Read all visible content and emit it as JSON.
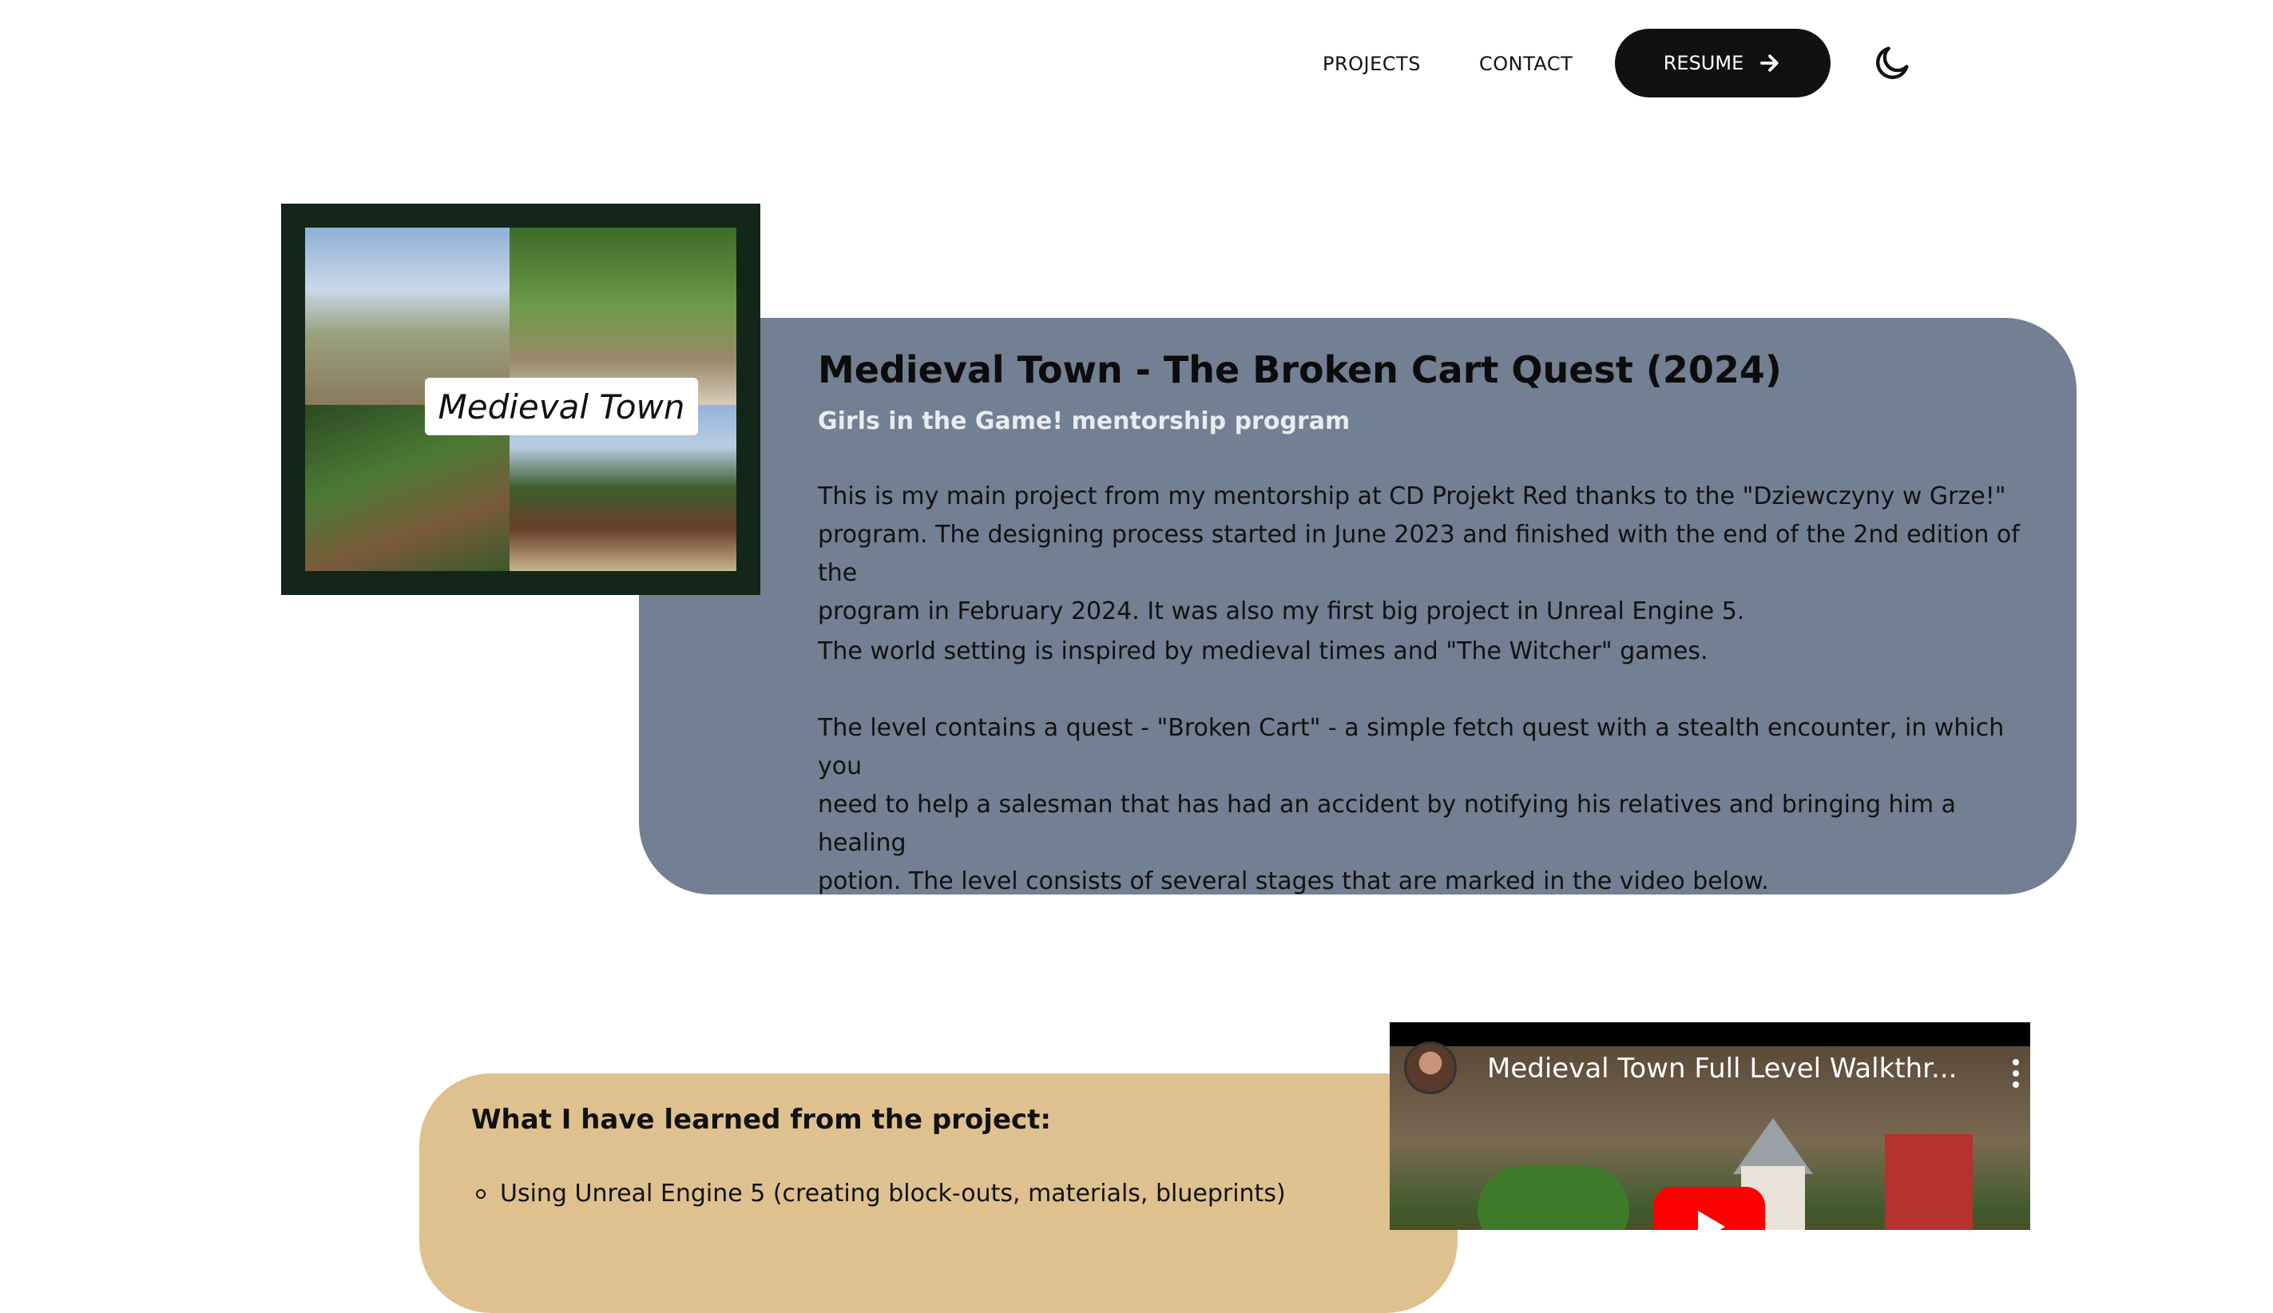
{
  "nav": {
    "projects": "PROJECTS",
    "contact": "CONTACT",
    "resume": "RESUME",
    "resume_icon": "arrow-right-icon",
    "theme_icon": "moon-icon"
  },
  "project": {
    "thumbnail_label": "Medieval Town",
    "title": "Medieval Town - The Broken Cart Quest (2024)",
    "subtitle": "Girls in the Game! mentorship program",
    "paragraph_1_line_1": "This is my main project from my mentorship at CD Projekt Red thanks to the \"Dziewczyny w Grze!\"",
    "paragraph_1_line_2": "program. The designing process started in June 2023 and finished with the end of the 2nd edition of the",
    "paragraph_1_line_3": "program in February 2024. It was also my first big project in Unreal Engine 5.",
    "paragraph_2": "The world setting is inspired by medieval times and \"The Witcher\" games.",
    "paragraph_3_line_1": "The level contains a quest - \"Broken Cart\" - a simple fetch quest with a stealth encounter, in which you",
    "paragraph_3_line_2": "need to help a salesman that has had an accident by notifying his relatives and bringing him a healing",
    "paragraph_3_line_3": "potion. The level consists of several stages that are marked in the video below."
  },
  "learned": {
    "title": "What I have learned from the project:",
    "items": [
      "Using Unreal Engine 5 (creating block-outs, materials, blueprints)"
    ]
  },
  "video": {
    "title": "Medieval Town Full Level Walkthr..."
  },
  "colors": {
    "project_card": "#737f92",
    "learned_card": "#dfc18f",
    "thumbnail_frame": "#12261a",
    "play_button": "#ff0000"
  }
}
